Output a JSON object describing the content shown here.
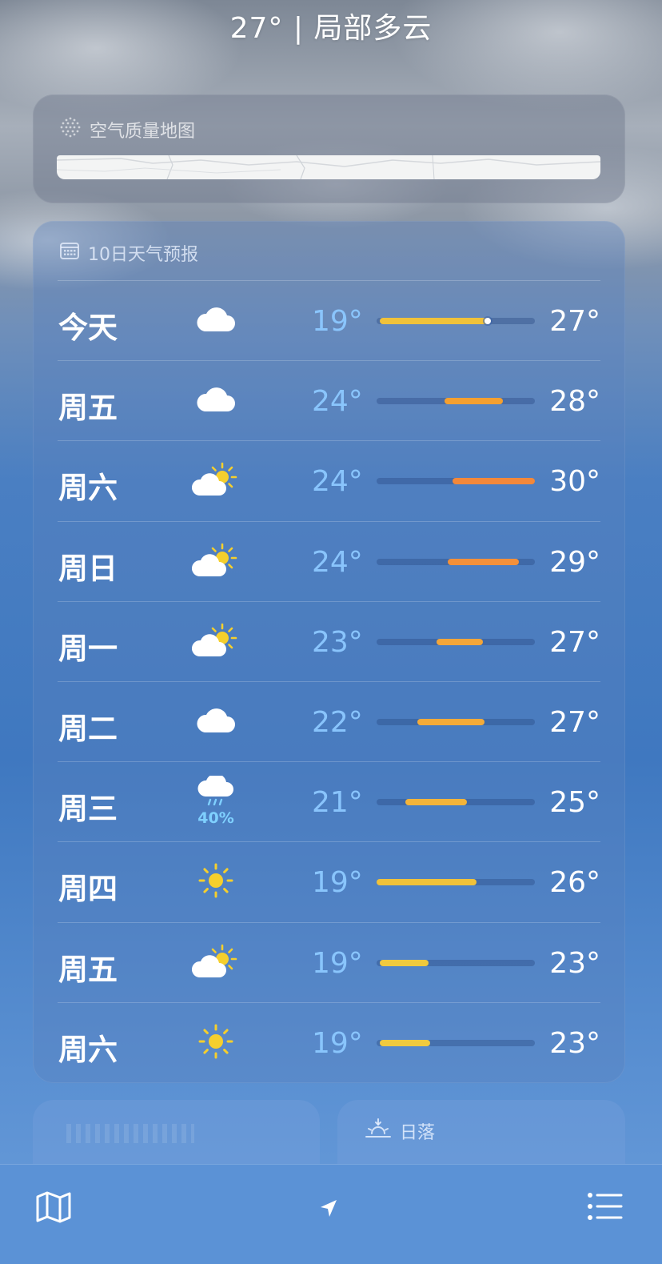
{
  "header": {
    "summary": "27°  |  局部多云"
  },
  "air_quality": {
    "title": "空气质量地图"
  },
  "forecast": {
    "title": "10日天气预报",
    "days": [
      {
        "day": "今天",
        "icon": "cloud-icon",
        "precip": "",
        "low": "19°",
        "high": "27°",
        "bar_start": 0.02,
        "bar_end": 0.7,
        "current": 0.7,
        "bar_color": "#f0c23a"
      },
      {
        "day": "周五",
        "icon": "cloud-icon",
        "precip": "",
        "low": "24°",
        "high": "28°",
        "bar_start": 0.43,
        "bar_end": 0.8,
        "bar_color": "#f5a030"
      },
      {
        "day": "周六",
        "icon": "partly-sunny-icon",
        "precip": "",
        "low": "24°",
        "high": "30°",
        "bar_start": 0.48,
        "bar_end": 1.0,
        "bar_color": "#f3883a"
      },
      {
        "day": "周日",
        "icon": "partly-sunny-icon",
        "precip": "",
        "low": "24°",
        "high": "29°",
        "bar_start": 0.45,
        "bar_end": 0.9,
        "bar_color": "#f3903a"
      },
      {
        "day": "周一",
        "icon": "partly-sunny-icon",
        "precip": "",
        "low": "23°",
        "high": "27°",
        "bar_start": 0.38,
        "bar_end": 0.67,
        "bar_color": "#f3a63a"
      },
      {
        "day": "周二",
        "icon": "cloud-icon",
        "precip": "",
        "low": "22°",
        "high": "27°",
        "bar_start": 0.26,
        "bar_end": 0.68,
        "bar_color": "#f3ab3a"
      },
      {
        "day": "周三",
        "icon": "rain-icon",
        "precip": "40%",
        "low": "21°",
        "high": "25°",
        "bar_start": 0.18,
        "bar_end": 0.57,
        "bar_color": "#f3b43a"
      },
      {
        "day": "周四",
        "icon": "sun-icon",
        "precip": "",
        "low": "19°",
        "high": "26°",
        "bar_start": 0.0,
        "bar_end": 0.63,
        "bar_color": "#f0c23a"
      },
      {
        "day": "周五",
        "icon": "partly-sunny-icon",
        "precip": "",
        "low": "19°",
        "high": "23°",
        "bar_start": 0.02,
        "bar_end": 0.33,
        "bar_color": "#f0ca3e"
      },
      {
        "day": "周六",
        "icon": "sun-icon",
        "precip": "",
        "low": "19°",
        "high": "23°",
        "bar_start": 0.02,
        "bar_end": 0.34,
        "bar_color": "#f0ca3e"
      }
    ]
  },
  "sunset": {
    "title": "日落"
  },
  "tabbar": {
    "map_icon": "map-icon",
    "location_icon": "location-arrow-icon",
    "list_icon": "list-icon"
  }
}
